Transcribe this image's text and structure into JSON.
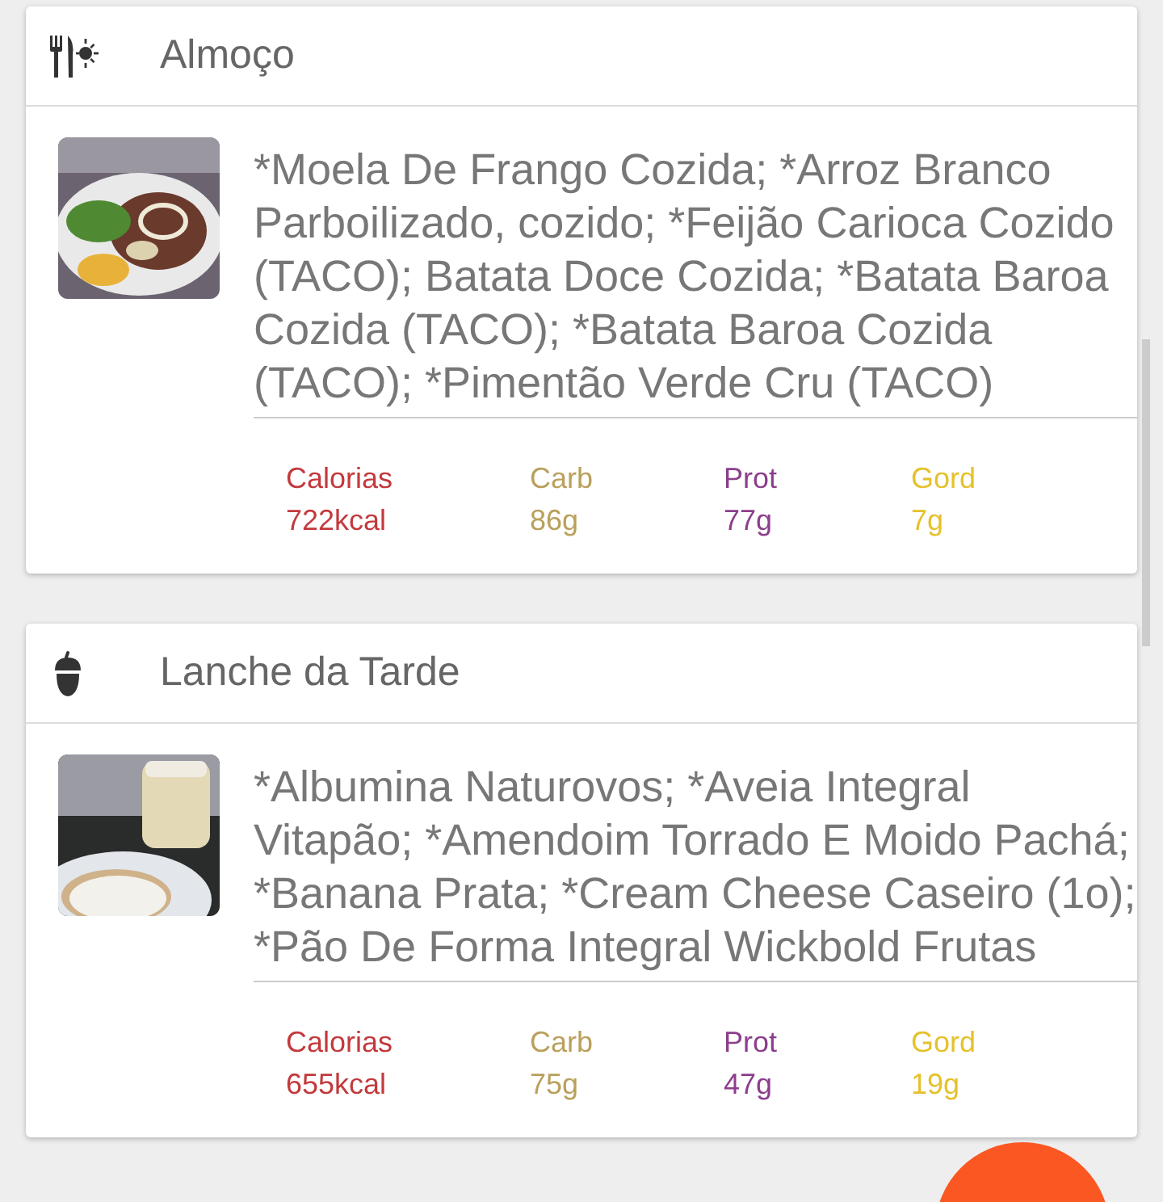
{
  "meals": [
    {
      "kind": "lunch",
      "title": "Almoço",
      "foods": "*Moela De Frango Cozida; *Arroz Branco Parboilizado, cozido; *Feijão Carioca Cozido (TACO); Batata Doce Cozida; *Batata Baroa Cozida (TACO); *Batata Baroa Cozida (TACO); *Pimentão Verde Cru (TACO)",
      "nutrients": [
        {
          "label": "Calorias",
          "value": "722kcal",
          "color": "#c3393c"
        },
        {
          "label": "Carb",
          "value": "86g",
          "color": "#b9a05c"
        },
        {
          "label": "Prot",
          "value": "77g",
          "color": "#8c3e8c"
        },
        {
          "label": "Gord",
          "value": "7g",
          "color": "#e6c12b"
        }
      ]
    },
    {
      "kind": "snack",
      "title": "Lanche da Tarde",
      "foods": "*Albumina Naturovos; *Aveia Integral Vitapão; *Amendoim Torrado E Moido Pachá; *Banana Prata; *Cream Cheese Caseiro (1o); *Pão De Forma Integral Wickbold Frutas",
      "nutrients": [
        {
          "label": "Calorias",
          "value": "655kcal",
          "color": "#c3393c"
        },
        {
          "label": "Carb",
          "value": "75g",
          "color": "#b9a05c"
        },
        {
          "label": "Prot",
          "value": "47g",
          "color": "#8c3e8c"
        },
        {
          "label": "Gord",
          "value": "19g",
          "color": "#e6c12b"
        }
      ]
    }
  ]
}
